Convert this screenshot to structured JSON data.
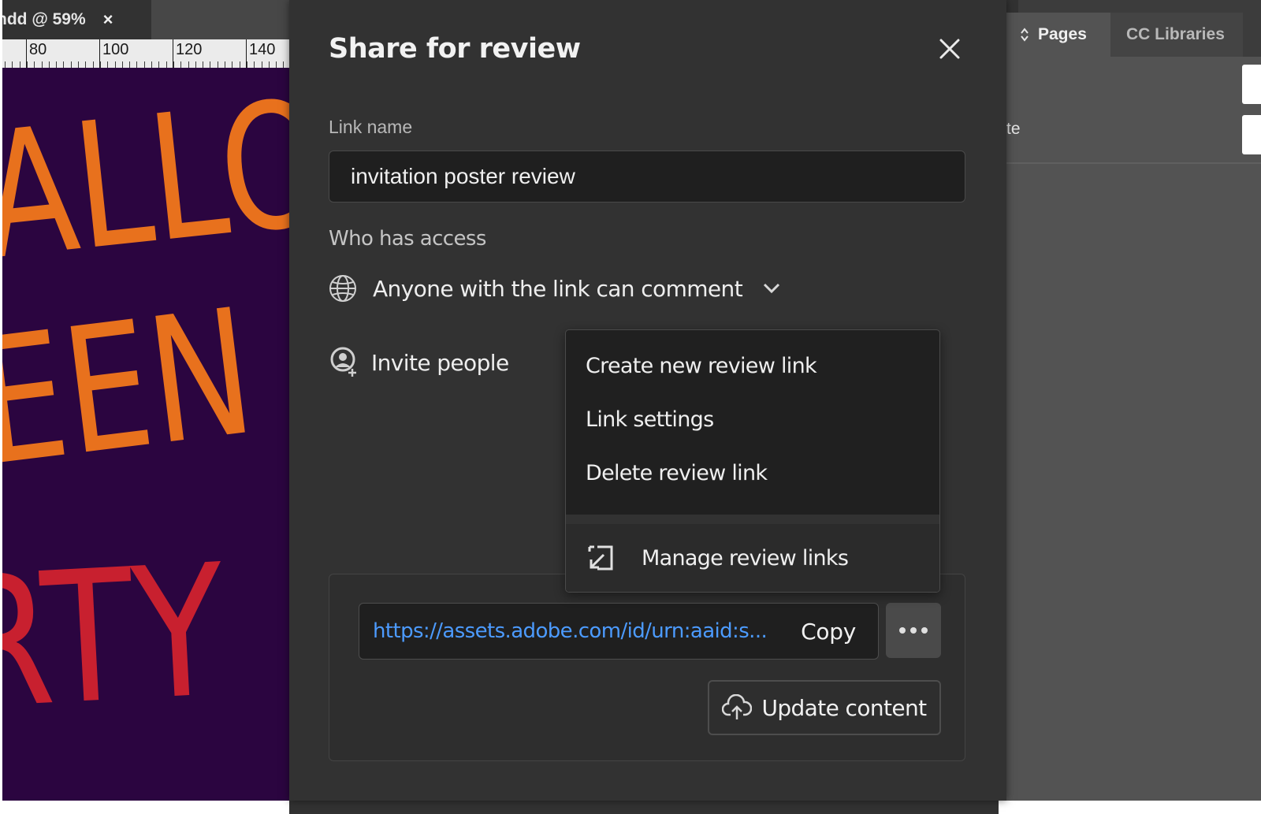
{
  "document": {
    "tab_title": "ndd @ 59%",
    "tab_close": "×",
    "ruler": [
      "80",
      "100",
      "120",
      "140"
    ],
    "artwork_lines": [
      "ALLO",
      "EEN",
      "RTY"
    ],
    "colors": {
      "background": "#2b0540",
      "orange": "#e8711d",
      "red": "#c8202f"
    }
  },
  "right_panel": {
    "tabs": [
      {
        "label": "Pages",
        "icon": "up-down-arrows-icon"
      },
      {
        "label": "CC Libraries"
      }
    ],
    "partial_text": "te"
  },
  "dialog": {
    "title": "Share for review",
    "close_icon": "close-icon",
    "link_name_label": "Link name",
    "link_name_value": "invitation poster review",
    "access_label": "Who has access",
    "access_value": "Anyone with the link can comment",
    "access_icon": "globe-icon",
    "invite_label": "Invite people",
    "invite_icon": "invite-person-icon",
    "link_url": "https://assets.adobe.com/id/urn:aaid:s...",
    "copy_label": "Copy",
    "more_icon": "more-options-icon",
    "update_label": "Update content",
    "update_icon": "cloud-upload-icon"
  },
  "menu": {
    "items": [
      "Create new review link",
      "Link settings",
      "Delete review link"
    ],
    "manage_label": "Manage review links",
    "manage_icon": "open-external-icon"
  },
  "colors": {
    "dialog_bg": "#323232",
    "input_bg": "#1f1f1f",
    "link_blue": "#4c9bff",
    "panel_bg": "#535353"
  }
}
